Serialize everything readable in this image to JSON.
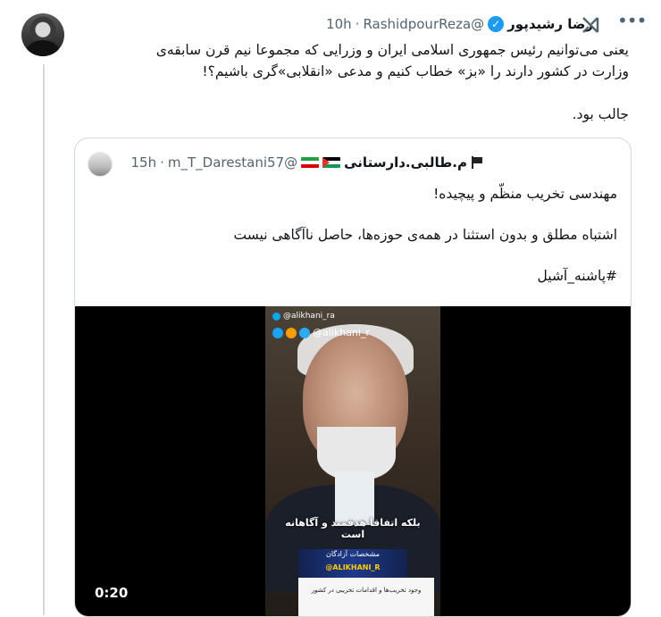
{
  "tweet": {
    "author_name": "رضا رشیدپور",
    "handle": "@RashidpourReza",
    "separator": "·",
    "time": "10h",
    "text_line1": "یعنی می‌توانیم رئیس جمهوری اسلامی ایران و وزرایی که مجموعا نیم قرن سابقه‌ی",
    "text_line2": "وزارت در کشور دارند را «بز» خطاب کنیم و مدعی «انقلابی»گری باشیم؟!",
    "text_line3": "جالب بود."
  },
  "quoted": {
    "author_name": "م.طالبی.دارستانی",
    "handle": "@m_T_Darestani57",
    "separator": "·",
    "time": "15h",
    "line1": "مهندسی تخریب منظّم و پیچیده!",
    "line2": "اشتباه مطلق و بدون استثنا در همه‌ی حوزه‌ها، حاصل ناآگاهی نیست",
    "line3": "#پاشنه_آشیل",
    "video": {
      "watermark_top": "@alikhani_ra",
      "watermark_main": "@alikhani_r",
      "caption": "بلکه اتفاقا هدفمند و آگاهانه است",
      "banner_title": "مشخصات آزادگان",
      "banner_handle": "@ALIKHANI_R",
      "lower_text": "وجود تخریب‌ها و اقدامات تخریبی در کشور",
      "duration": "0:20"
    }
  },
  "icons": {
    "grok": "grok-icon",
    "more": "more-icon",
    "verified": "verified-badge-icon"
  },
  "colors": {
    "accent": "#1d9bf0",
    "secondary_text": "#536471",
    "border": "#cfd9de"
  }
}
